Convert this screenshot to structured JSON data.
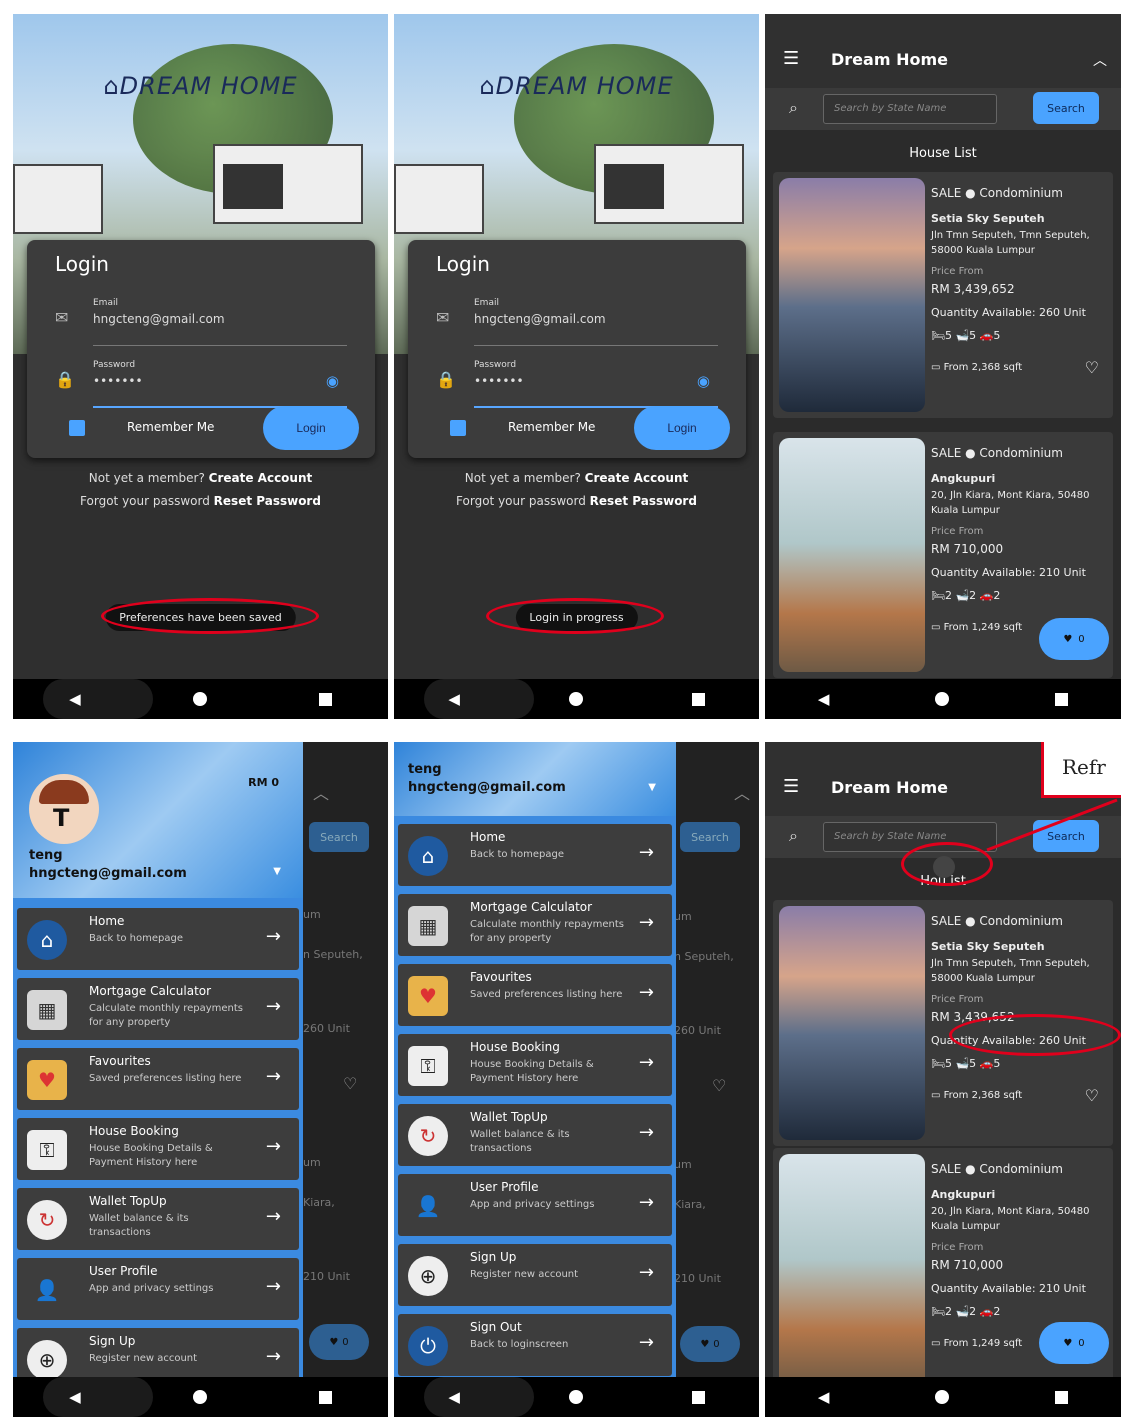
{
  "login": {
    "logo": "DREAM HOME",
    "title": "Login",
    "email_label": "Email",
    "email_value": "hngcteng@gmail.com",
    "password_label": "Password",
    "password_value": "•••••••",
    "remember": "Remember Me",
    "login_button": "Login",
    "member_text": "Not yet a member?",
    "create_account": "Create Account",
    "forgot_text": "Forgot your password",
    "reset_password": "Reset Password",
    "toast_1": "Preferences have been saved",
    "toast_2": "Login in progress"
  },
  "list": {
    "app_title": "Dream Home",
    "search_placeholder": "Search by State Name",
    "search_button": "Search",
    "section_title": "House List",
    "section_title_partial": "Hou    ist",
    "houses": [
      {
        "type": "SALE ● Condominium",
        "name": "Setia Sky Seputeh",
        "address": "Jln Tmn Seputeh, Tmn Seputeh, 58000 Kuala Lumpur",
        "price_label": "Price From",
        "price": "RM 3,439,652",
        "qty": "Quantity Available: 260 Unit",
        "beds": "5",
        "baths": "5",
        "cars": "5",
        "area": "From 2,368 sqft"
      },
      {
        "type": "SALE ● Condominium",
        "name": "Angkupuri",
        "address": "20, Jln Kiara, Mont Kiara, 50480 Kuala Lumpur",
        "price_label": "Price From",
        "price": "RM 710,000",
        "qty": "Quantity Available: 210 Unit",
        "beds": "2",
        "baths": "2",
        "cars": "2",
        "area": "From 1,249 sqft"
      }
    ],
    "fab_count": "0",
    "refresh_label": "Refr"
  },
  "drawer": {
    "user": "teng",
    "email": "hngcteng@gmail.com",
    "balance": "RM 0",
    "items": [
      {
        "title": "Home",
        "sub": "Back to homepage"
      },
      {
        "title": "Mortgage Calculator",
        "sub": "Calculate monthly repayments for any property"
      },
      {
        "title": "Favourites",
        "sub": "Saved preferences listing here"
      },
      {
        "title": "House Booking",
        "sub": "House Booking Details & Payment History here"
      },
      {
        "title": "Wallet TopUp",
        "sub": "Wallet balance & its transactions"
      },
      {
        "title": "User Profile",
        "sub": "App and privacy settings"
      },
      {
        "title": "Sign Up",
        "sub": "Register new account"
      },
      {
        "title": "Sign Out",
        "sub": "Back to loginscreen"
      }
    ],
    "bg_texts": {
      "search": "Search",
      "um": "um",
      "seputeh": "n Seputeh,",
      "unit260": "260 Unit",
      "unit210": "210 Unit",
      "kiara": "Kiara,",
      "zero": "0"
    }
  },
  "colors": {
    "accent": "#4aa3ff",
    "background": "#2f2f2f",
    "annotation": "#e0001c"
  }
}
